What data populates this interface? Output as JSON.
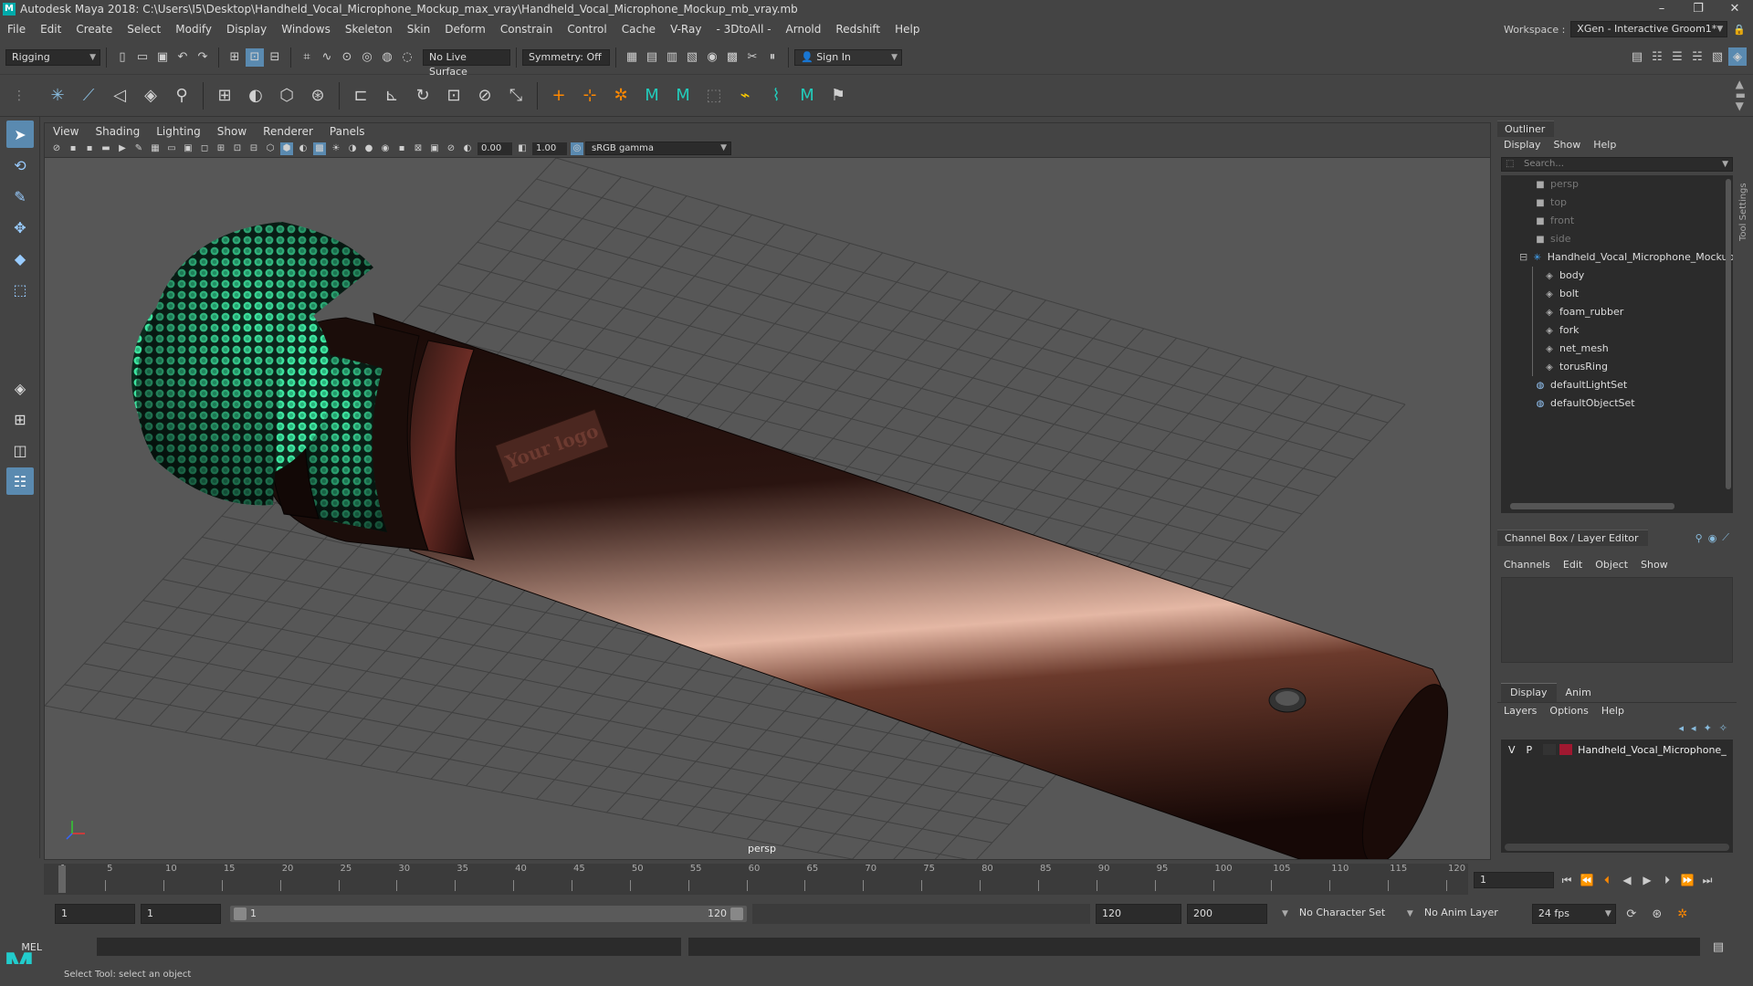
{
  "titlebar": {
    "title": "Autodesk Maya 2018: C:\\Users\\I5\\Desktop\\Handheld_Vocal_Microphone_Mockup_max_vray\\Handheld_Vocal_Microphone_Mockup_mb_vray.mb",
    "logo": "M"
  },
  "menus": [
    "File",
    "Edit",
    "Create",
    "Select",
    "Modify",
    "Display",
    "Windows",
    "Skeleton",
    "Skin",
    "Deform",
    "Constrain",
    "Control",
    "Cache",
    "V-Ray",
    "- 3DtoAll -",
    "Arnold",
    "Redshift",
    "Help"
  ],
  "workspace": {
    "label": "Workspace :",
    "value": "XGen - Interactive Groom1*"
  },
  "shelf": {
    "mode": "Rigging",
    "live_surface": "No Live Surface",
    "symmetry": "Symmetry: Off",
    "sign_in": "Sign In"
  },
  "viewport": {
    "menus": [
      "View",
      "Shading",
      "Lighting",
      "Show",
      "Renderer",
      "Panels"
    ],
    "exposure": "0.00",
    "gamma": "1.00",
    "colorspace": "sRGB gamma",
    "camera": "persp",
    "logo_text": "Your logo"
  },
  "outliner": {
    "title": "Outliner",
    "menus": [
      "Display",
      "Show",
      "Help"
    ],
    "search_placeholder": "Search...",
    "items": [
      {
        "label": "persp",
        "dim": true,
        "icon": "camera-icon"
      },
      {
        "label": "top",
        "dim": true,
        "icon": "camera-icon"
      },
      {
        "label": "front",
        "dim": true,
        "icon": "camera-icon"
      },
      {
        "label": "side",
        "dim": true,
        "icon": "camera-icon"
      },
      {
        "label": "Handheld_Vocal_Microphone_Mockup",
        "dim": false,
        "icon": "group-icon"
      },
      {
        "label": "body",
        "dim": false,
        "icon": "mesh-icon"
      },
      {
        "label": "bolt",
        "dim": false,
        "icon": "mesh-icon"
      },
      {
        "label": "foam_rubber",
        "dim": false,
        "icon": "mesh-icon"
      },
      {
        "label": "fork",
        "dim": false,
        "icon": "mesh-icon"
      },
      {
        "label": "net_mesh",
        "dim": false,
        "icon": "mesh-icon"
      },
      {
        "label": "torusRing",
        "dim": false,
        "icon": "mesh-icon"
      },
      {
        "label": "defaultLightSet",
        "dim": false,
        "icon": "set-icon"
      },
      {
        "label": "defaultObjectSet",
        "dim": false,
        "icon": "set-icon"
      }
    ]
  },
  "channelbox": {
    "title": "Channel Box / Layer Editor",
    "menus": [
      "Channels",
      "Edit",
      "Object",
      "Show"
    ]
  },
  "layers": {
    "tabs": [
      "Display",
      "Anim"
    ],
    "menus": [
      "Layers",
      "Options",
      "Help"
    ],
    "layer": {
      "v": "V",
      "p": "P",
      "name": "Handheld_Vocal_Microphone_"
    },
    "color": "#a01830"
  },
  "timeline": {
    "ticks": [
      "1",
      "5",
      "10",
      "15",
      "20",
      "25",
      "30",
      "35",
      "40",
      "45",
      "50",
      "55",
      "60",
      "65",
      "70",
      "75",
      "80",
      "85",
      "90",
      "95",
      "100",
      "105",
      "110",
      "115",
      "120"
    ],
    "current": "1"
  },
  "range": {
    "start": "1",
    "anim_start": "1",
    "slider_start": "1",
    "slider_end": "120",
    "end": "120",
    "anim_end": "200",
    "character": "No Character Set",
    "anim_layer": "No Anim Layer",
    "fps": "24 fps"
  },
  "cmdline": {
    "label": "MEL"
  },
  "status": {
    "text": "Select Tool: select an object"
  },
  "toolsettings": "Tool Settings"
}
